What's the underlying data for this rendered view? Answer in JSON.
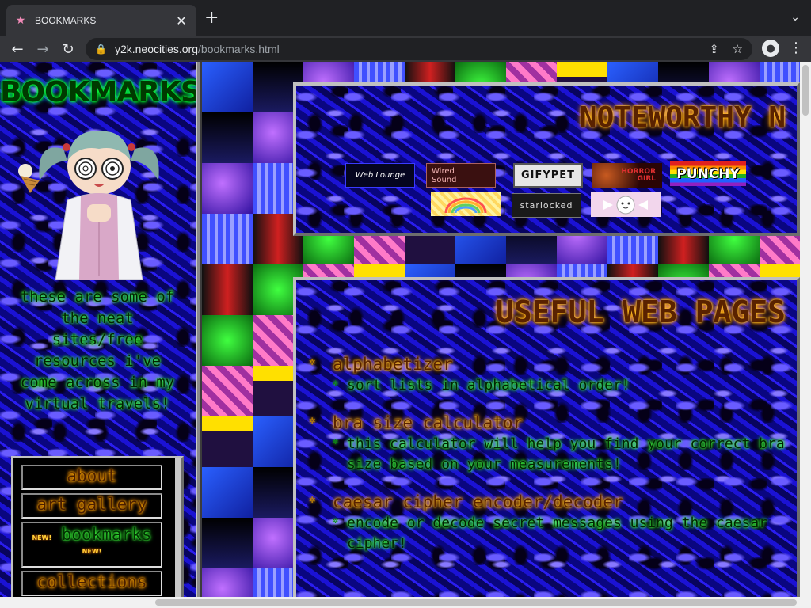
{
  "browser": {
    "tab_title": "BOOKMARKS",
    "url_host": "y2k.neocities.org",
    "url_path": "/bookmarks.html",
    "icons": [
      "star-favicon",
      "close-icon",
      "new-tab-icon",
      "tab-search-icon",
      "back-icon",
      "forward-icon",
      "reload-icon",
      "lock-icon",
      "share-icon",
      "bookmark-star-icon",
      "profile-icon",
      "menu-icon"
    ]
  },
  "sidebar": {
    "title": "BOOKMARKS",
    "tagline": "these are some of the neat sites/free resources i've come across in my virtual travels!",
    "nav": [
      {
        "label": "about",
        "current": false
      },
      {
        "label": "art gallery",
        "current": false
      },
      {
        "label": "bookmarks",
        "current": true,
        "badge": "NEW!"
      },
      {
        "label": "collections",
        "current": false
      }
    ]
  },
  "noteworthy": {
    "heading": "NOTEWORTHY N",
    "buttons": [
      {
        "line1": "",
        "line2": "Web Lounge"
      },
      {
        "line1": "Wired",
        "line2": "Sound"
      },
      {
        "line1": "GIFYPET",
        "line2": ""
      },
      {
        "line1": "HORROR",
        "line2": "GIRL"
      },
      {
        "line1": "PUNCHY",
        "line2": ""
      },
      {
        "line1": "",
        "line2": ""
      },
      {
        "line1": "starlocked",
        "line2": ""
      },
      {
        "line1": "",
        "line2": ""
      }
    ]
  },
  "useful": {
    "heading": "USEFUL WEB PAGES",
    "items": [
      {
        "name": "alphabetizer",
        "desc": "sort lists in alphabetical order!"
      },
      {
        "name": "bra size calculator",
        "desc": "this calculator will help you find your correct bra size based on your measurements!"
      },
      {
        "name": "caesar cipher encoder/decoder",
        "desc": "encode or decode secret messages using the caesar cipher!"
      }
    ]
  },
  "colors": {
    "glow_green": "#3dff3d",
    "glow_orange": "#ffaa00",
    "swirl_blue": "#1b12d4"
  }
}
